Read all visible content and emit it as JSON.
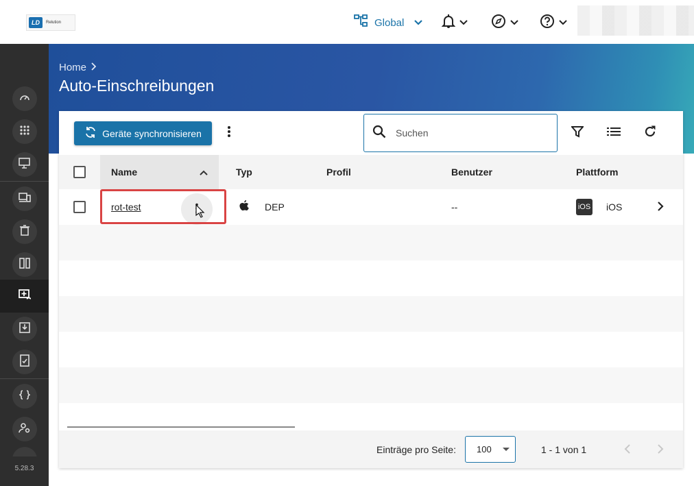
{
  "topbar": {
    "logo_text": "Relution",
    "logo_mark": "LD",
    "global_label": "Global",
    "icons": [
      "hierarchy-icon",
      "chevron-down-icon",
      "bell-icon",
      "compass-icon",
      "help-icon"
    ]
  },
  "sidebar": {
    "items": [
      {
        "name": "dashboard-icon"
      },
      {
        "name": "apps-grid-icon"
      },
      {
        "name": "device-settings-icon"
      },
      {
        "name": "devices-icon"
      },
      {
        "name": "trash-icon"
      },
      {
        "name": "device-pair-icon"
      },
      {
        "name": "enrollment-icon",
        "active": true
      },
      {
        "name": "download-icon"
      },
      {
        "name": "compliance-icon"
      },
      {
        "name": "code-braces-icon"
      },
      {
        "name": "user-settings-icon"
      }
    ],
    "version": "5.28.3"
  },
  "header": {
    "breadcrumb": "Home",
    "title": "Auto-Einschreibungen"
  },
  "toolbar": {
    "sync_label": "Geräte synchronisieren",
    "search_placeholder": "Suchen"
  },
  "table": {
    "columns": {
      "name": "Name",
      "type": "Typ",
      "profile": "Profil",
      "user": "Benutzer",
      "platform": "Plattform"
    },
    "rows": [
      {
        "name": "rot-test",
        "type": "DEP",
        "profile": "",
        "user": "--",
        "platform_badge": "iOS",
        "platform": "iOS"
      }
    ]
  },
  "pagination": {
    "per_page_label": "Einträge pro Seite:",
    "per_page_value": "100",
    "range": "1 - 1 von 1"
  },
  "colors": {
    "accent": "#1a73a8",
    "highlight": "#d94444",
    "sidebar": "#2e2e2e"
  }
}
